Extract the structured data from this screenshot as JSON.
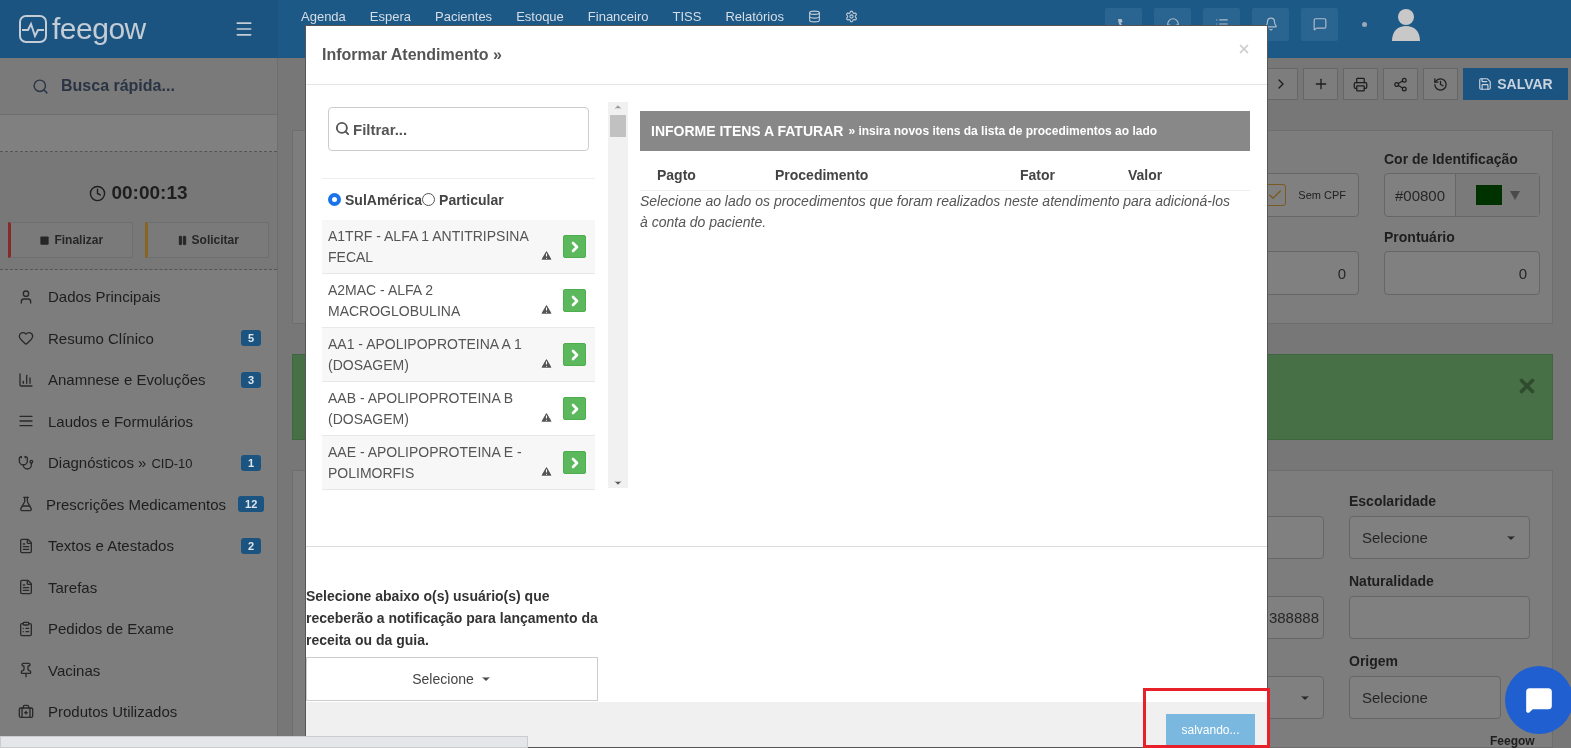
{
  "header": {
    "logo": "feegow",
    "nav": [
      "Agenda",
      "Espera",
      "Pacientes",
      "Estoque",
      "Financeiro",
      "TISS",
      "Relatórios"
    ]
  },
  "sidebar": {
    "search_placeholder": "Busca rápida...",
    "timer": "00:00:13",
    "actions": [
      {
        "label": "Finalizar",
        "kind": "stop"
      },
      {
        "label": "Solicitar",
        "kind": "pause"
      }
    ],
    "items": [
      {
        "label": "Dados Principais"
      },
      {
        "label": "Resumo Clínico",
        "badge": "5"
      },
      {
        "label": "Anamnese e Evoluções",
        "badge": "3"
      },
      {
        "label": "Laudos e Formulários"
      },
      {
        "label": "Diagnósticos »",
        "suffix": "CID-10",
        "badge": "1"
      },
      {
        "label": "Prescrições Medicamentos",
        "badge": "12"
      },
      {
        "label": "Textos e Atestados",
        "badge": "2"
      },
      {
        "label": "Tarefas"
      },
      {
        "label": "Pedidos de Exame"
      },
      {
        "label": "Vacinas"
      },
      {
        "label": "Produtos Utilizados"
      }
    ]
  },
  "toolbar": {
    "save": "SALVAR"
  },
  "patient_card": {
    "sem_cpf": {
      "label": "Sem CPF",
      "checked": true
    },
    "color_label": "Cor de Identificação",
    "color_value": "#00800",
    "field_value": "0",
    "prontuario_label": "Prontuário",
    "prontuario_value": "0"
  },
  "form": {
    "left_value": "388888",
    "escolaridade": {
      "label": "Escolaridade",
      "value": "Selecione"
    },
    "naturalidade": {
      "label": "Naturalidade"
    },
    "origem": {
      "label": "Origem",
      "value": "Selecione"
    }
  },
  "footer": {
    "brand": "Feegow"
  },
  "modal": {
    "title": "Informar Atendimento »",
    "filter_placeholder": "Filtrar...",
    "options": [
      {
        "label": "SulAmérica",
        "selected": true
      },
      {
        "label": "Particular",
        "selected": false
      }
    ],
    "procedures": [
      {
        "text": "A1TRF - ALFA 1 ANTITRIPSINA FECAL"
      },
      {
        "text": "A2MAC - ALFA 2 MACROGLOBULINA"
      },
      {
        "text": "AA1 - APOLIPOPROTEINA A 1 (DOSAGEM)"
      },
      {
        "text": "AAB - APOLIPOPROTEINA B (DOSAGEM)"
      },
      {
        "text": "AAE - APOLIPOPROTEINA E - POLIMORFIS"
      }
    ],
    "billing": {
      "title": "INFORME ITENS A FATURAR",
      "subtitle": "» insira novos itens da lista de procedimentos ao lado",
      "columns": [
        "Pagto",
        "Procedimento",
        "Fator",
        "Valor"
      ],
      "empty": "Selecione ao lado os procedimentos que foram realizados neste atendimento para adicioná-los à conta do paciente."
    },
    "notify": {
      "text": "Selecione abaixo o(s) usuário(s) que receberão a notificação para lançamento da receita ou da guia.",
      "select": "Selecione"
    },
    "submit": "salvando..."
  }
}
